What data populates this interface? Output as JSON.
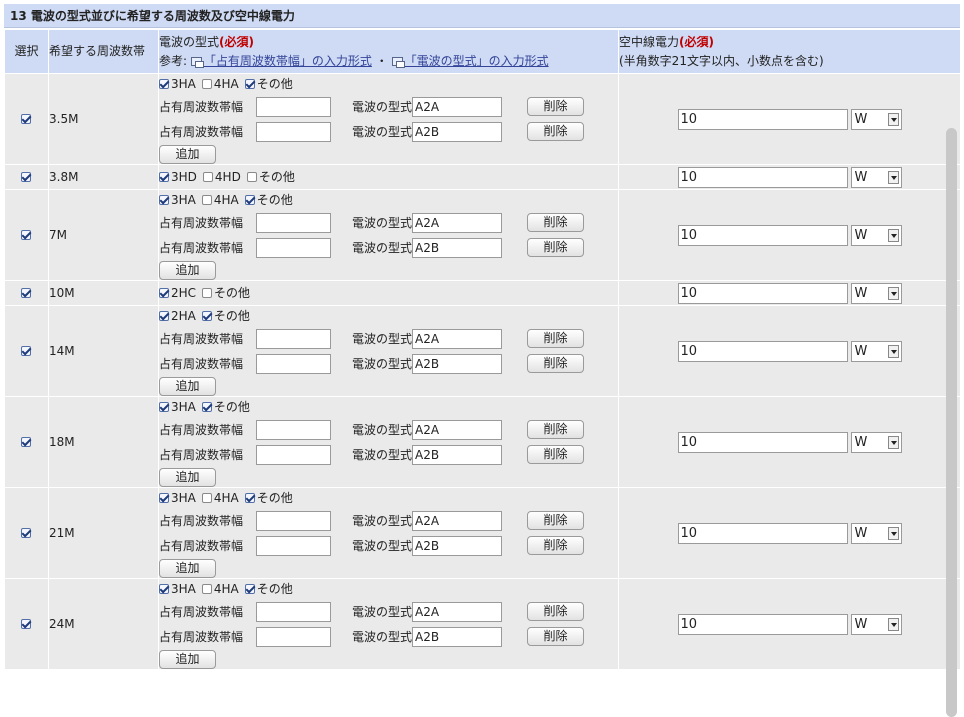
{
  "section_title": "13 電波の型式並びに希望する周波数及び空中線電力",
  "headers": {
    "select": "選択",
    "band": "希望する周波数帯",
    "types_title": "電波の型式",
    "required": "(必須)",
    "ref_prefix": "参考:",
    "ref_link1": "「占有周波数帯幅」の入力形式",
    "ref_sep": "・",
    "ref_link2": "「電波の型式」の入力形式",
    "power_title": "空中線電力",
    "power_note": "(半角数字21文字以内、小数点を含む)"
  },
  "labels": {
    "occupied_bw": "占有周波数帯幅",
    "emission_type": "電波の型式",
    "delete": "削除",
    "add": "追加"
  },
  "rows": [
    {
      "band": "3.5M",
      "selected": true,
      "checks": [
        {
          "label": "3HA",
          "checked": true
        },
        {
          "label": "4HA",
          "checked": false
        },
        {
          "label": "その他",
          "checked": true
        }
      ],
      "details": [
        {
          "bw": "",
          "type": "A2A"
        },
        {
          "bw": "",
          "type": "A2B"
        }
      ],
      "power": "10",
      "unit": "W"
    },
    {
      "band": "3.8M",
      "selected": true,
      "checks": [
        {
          "label": "3HD",
          "checked": true
        },
        {
          "label": "4HD",
          "checked": false
        },
        {
          "label": "その他",
          "checked": false
        }
      ],
      "details": [],
      "power": "10",
      "unit": "W"
    },
    {
      "band": "7M",
      "selected": true,
      "checks": [
        {
          "label": "3HA",
          "checked": true
        },
        {
          "label": "4HA",
          "checked": false
        },
        {
          "label": "その他",
          "checked": true
        }
      ],
      "details": [
        {
          "bw": "",
          "type": "A2A"
        },
        {
          "bw": "",
          "type": "A2B"
        }
      ],
      "power": "10",
      "unit": "W"
    },
    {
      "band": "10M",
      "selected": true,
      "checks": [
        {
          "label": "2HC",
          "checked": true
        },
        {
          "label": "その他",
          "checked": false
        }
      ],
      "details": [],
      "power": "10",
      "unit": "W"
    },
    {
      "band": "14M",
      "selected": true,
      "checks": [
        {
          "label": "2HA",
          "checked": true
        },
        {
          "label": "その他",
          "checked": true
        }
      ],
      "details": [
        {
          "bw": "",
          "type": "A2A"
        },
        {
          "bw": "",
          "type": "A2B"
        }
      ],
      "power": "10",
      "unit": "W"
    },
    {
      "band": "18M",
      "selected": true,
      "checks": [
        {
          "label": "3HA",
          "checked": true
        },
        {
          "label": "その他",
          "checked": true
        }
      ],
      "details": [
        {
          "bw": "",
          "type": "A2A"
        },
        {
          "bw": "",
          "type": "A2B"
        }
      ],
      "power": "10",
      "unit": "W"
    },
    {
      "band": "21M",
      "selected": true,
      "checks": [
        {
          "label": "3HA",
          "checked": true
        },
        {
          "label": "4HA",
          "checked": false
        },
        {
          "label": "その他",
          "checked": true
        }
      ],
      "details": [
        {
          "bw": "",
          "type": "A2A"
        },
        {
          "bw": "",
          "type": "A2B"
        }
      ],
      "power": "10",
      "unit": "W"
    },
    {
      "band": "24M",
      "selected": true,
      "checks": [
        {
          "label": "3HA",
          "checked": true
        },
        {
          "label": "4HA",
          "checked": false
        },
        {
          "label": "その他",
          "checked": true
        }
      ],
      "details": [
        {
          "bw": "",
          "type": "A2A"
        },
        {
          "bw": "",
          "type": "A2B"
        }
      ],
      "power": "10",
      "unit": "W"
    }
  ]
}
